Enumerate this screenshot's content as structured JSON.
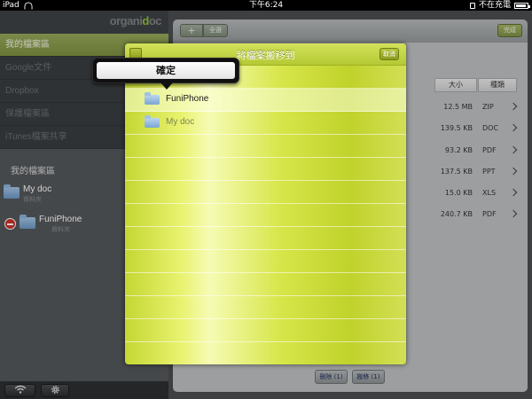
{
  "statusbar": {
    "device": "iPad",
    "time": "下午6:24",
    "battery_text": "不在充電"
  },
  "sidebar": {
    "logo_prefix": "organi",
    "logo_accent": "d",
    "logo_suffix": "oc",
    "menu": [
      {
        "label": "我的檔案區",
        "active": true
      },
      {
        "label": "Google文件",
        "active": false
      },
      {
        "label": "Dropbox",
        "active": false
      },
      {
        "label": "保護檔案區",
        "active": false
      },
      {
        "label": "iTunes檔案共享",
        "active": false
      }
    ],
    "section_label": "我的檔案區",
    "files": [
      {
        "name": "My doc",
        "sub": "資料夾"
      },
      {
        "name": "FuniPhone",
        "sub": "資料夾"
      }
    ],
    "bottom_icons": [
      "wifi-icon",
      "gear-icon"
    ]
  },
  "main": {
    "toolbar": {
      "add_label": "+",
      "select_all_label": "全選",
      "done_label": "完成"
    },
    "columns": {
      "size": "大小",
      "type": "種類"
    },
    "files": [
      {
        "size": "12.5 MB",
        "type": "ZIP"
      },
      {
        "size": "139.5 KB",
        "type": "DOC"
      },
      {
        "size": "93.2 KB",
        "type": "PDF"
      },
      {
        "size": "137.5 KB",
        "type": "PPT"
      },
      {
        "size": "15.0 KB",
        "type": "XLS"
      },
      {
        "size": "240.7 KB",
        "type": "PDF"
      }
    ],
    "actions": {
      "delete": "刪除 (1)",
      "move": "搬移 (1)"
    }
  },
  "dialog": {
    "title": "將檔案搬移到",
    "close_label": "取消",
    "folders": [
      {
        "label": "FuniPhone",
        "selected": true
      },
      {
        "label": "My doc",
        "selected": false
      }
    ]
  },
  "popover": {
    "confirm_label": "確定"
  },
  "colors": {
    "accent_green": "#c4d733",
    "sidebar_active": "#8a9c4a",
    "delete_red": "#c8322b"
  }
}
